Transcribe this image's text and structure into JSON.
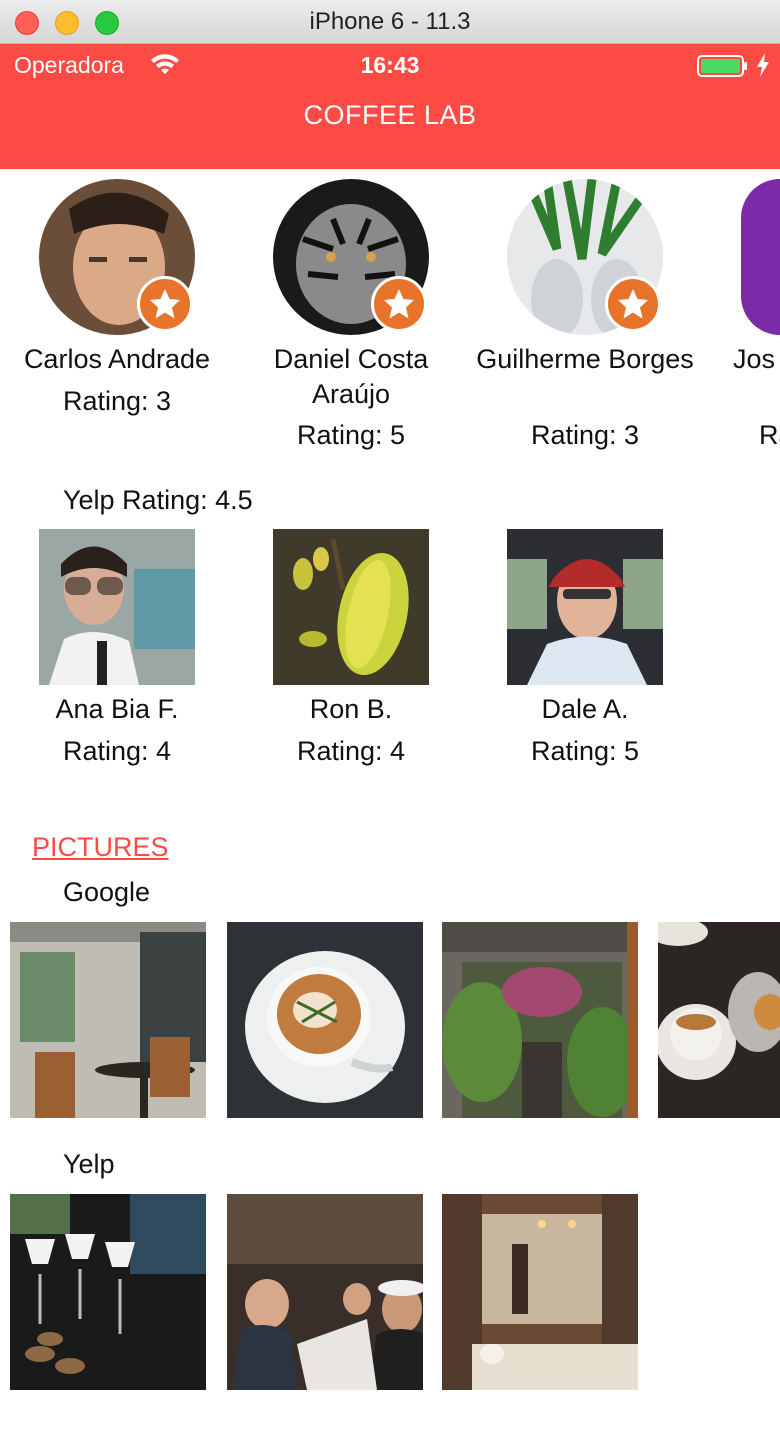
{
  "window": {
    "title": "iPhone 6 - 11.3"
  },
  "status_bar": {
    "carrier": "Operadora",
    "time": "16:43"
  },
  "nav": {
    "title": "COFFEE LAB"
  },
  "google_reviewers": [
    {
      "name": "Carlos Andrade",
      "rating": "Rating: 3"
    },
    {
      "name": "Daniel Costa Araújo",
      "rating": "Rating: 5"
    },
    {
      "name": "Guilherme Borges",
      "rating": "Rating: 3"
    },
    {
      "name": "Jos",
      "rating": "Ra"
    }
  ],
  "yelp_rating": "Yelp Rating: 4.5",
  "yelp_reviewers": [
    {
      "name": "Ana Bia F.",
      "rating": "Rating: 4"
    },
    {
      "name": "Ron B.",
      "rating": "Rating: 4"
    },
    {
      "name": "Dale A.",
      "rating": "Rating: 5"
    }
  ],
  "pictures": {
    "link": "PICTURES",
    "google_label": "Google",
    "yelp_label": "Yelp"
  },
  "colors": {
    "accent": "#fc4b44",
    "badge": "#e8742b"
  }
}
